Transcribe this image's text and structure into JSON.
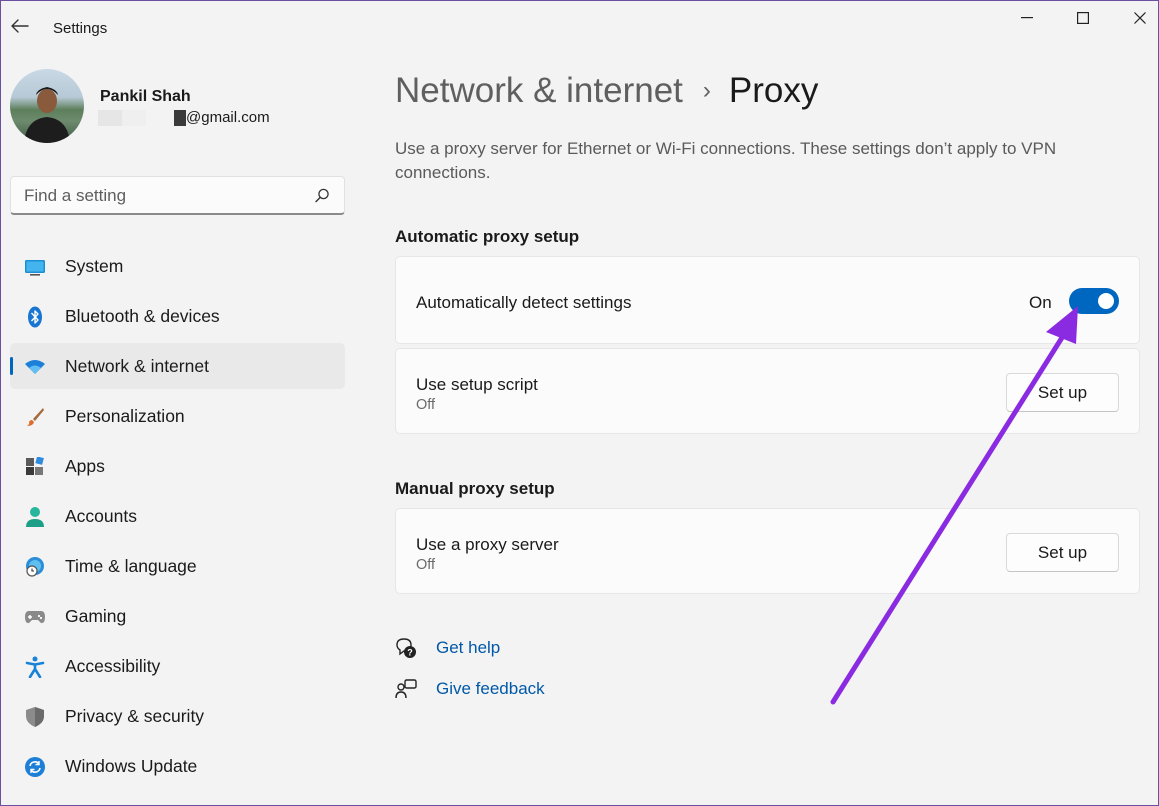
{
  "window": {
    "title": "Settings",
    "back_icon": "back-arrow-icon"
  },
  "profile": {
    "name": "Pankil Shah",
    "email_visible": "@gmail.com"
  },
  "search": {
    "placeholder": "Find a setting",
    "icon": "search-icon"
  },
  "sidebar": {
    "items": [
      {
        "label": "System",
        "icon": "system-icon"
      },
      {
        "label": "Bluetooth & devices",
        "icon": "bluetooth-icon"
      },
      {
        "label": "Network & internet",
        "icon": "wifi-icon",
        "active": true
      },
      {
        "label": "Personalization",
        "icon": "brush-icon"
      },
      {
        "label": "Apps",
        "icon": "apps-icon"
      },
      {
        "label": "Accounts",
        "icon": "accounts-icon"
      },
      {
        "label": "Time & language",
        "icon": "globe-clock-icon"
      },
      {
        "label": "Gaming",
        "icon": "gamepad-icon"
      },
      {
        "label": "Accessibility",
        "icon": "accessibility-icon"
      },
      {
        "label": "Privacy & security",
        "icon": "shield-icon"
      },
      {
        "label": "Windows Update",
        "icon": "update-icon"
      }
    ]
  },
  "main": {
    "breadcrumb_parent": "Network & internet",
    "breadcrumb_separator": "›",
    "breadcrumb_current": "Proxy",
    "description": "Use a proxy server for Ethernet or Wi-Fi connections. These settings don’t apply to VPN connections.",
    "automatic": {
      "title": "Automatic proxy setup",
      "detect": {
        "label": "Automatically detect settings",
        "state_label": "On",
        "enabled": true
      },
      "script": {
        "label": "Use setup script",
        "status": "Off",
        "button": "Set up"
      }
    },
    "manual": {
      "title": "Manual proxy setup",
      "proxy": {
        "label": "Use a proxy server",
        "status": "Off",
        "button": "Set up"
      }
    },
    "links": {
      "help": "Get help",
      "feedback": "Give feedback"
    }
  },
  "colors": {
    "accent": "#0067c0",
    "annotation_arrow": "#8a2be2"
  }
}
